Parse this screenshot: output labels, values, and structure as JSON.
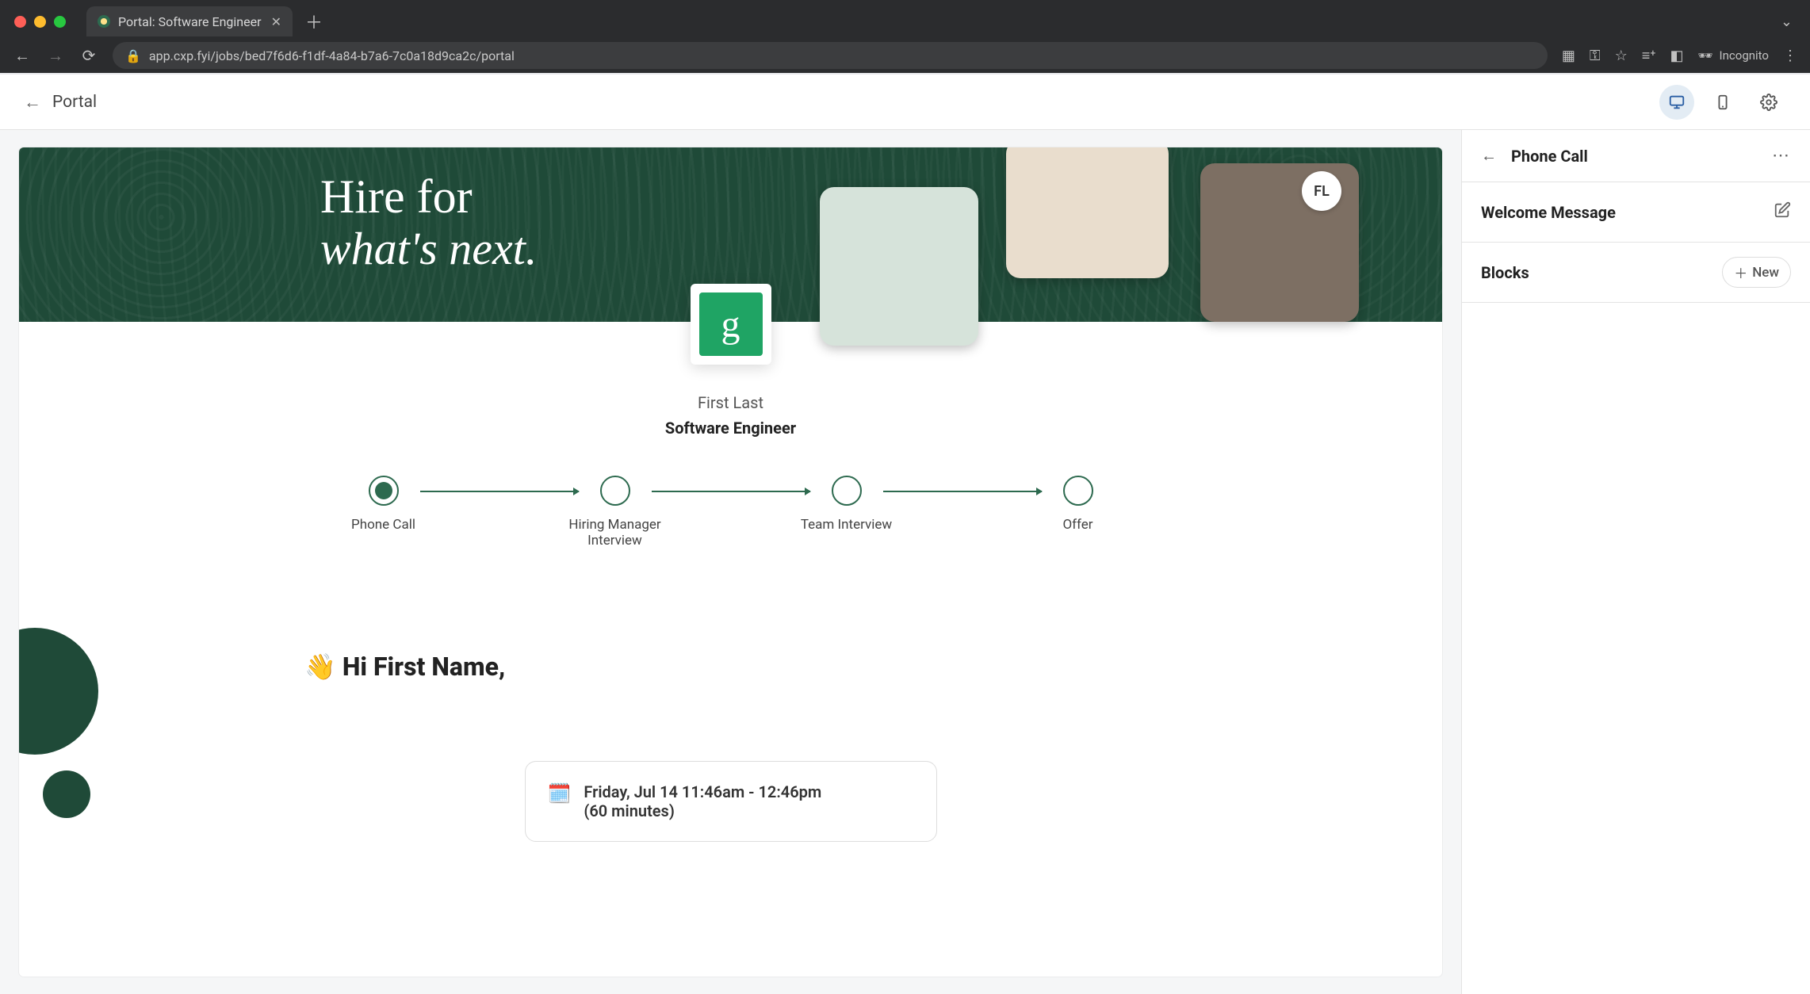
{
  "browser": {
    "tab_title": "Portal: Software Engineer",
    "url": "app.cxp.fyi/jobs/bed7f6d6-f1df-4a84-b7a6-7c0a18d9ca2c/portal",
    "incognito_label": "Incognito"
  },
  "app_header": {
    "title": "Portal"
  },
  "hero": {
    "line1": "Hire for",
    "line2": "what's next.",
    "initials": "FL"
  },
  "candidate": {
    "name": "First Last",
    "role": "Software Engineer"
  },
  "stages": {
    "items": [
      {
        "label": "Phone Call"
      },
      {
        "label": "Hiring Manager Interview"
      },
      {
        "label": "Team Interview"
      },
      {
        "label": "Offer"
      }
    ]
  },
  "welcome": {
    "heading": "👋 Hi First Name,",
    "schedule_line1": "Friday, Jul 14 11:46am - 12:46pm",
    "schedule_line2": "(60 minutes)",
    "calendar_icon": "🗓️"
  },
  "side_panel": {
    "title": "Phone Call",
    "welcome_section": "Welcome Message",
    "blocks_section": "Blocks",
    "new_button": "New"
  }
}
